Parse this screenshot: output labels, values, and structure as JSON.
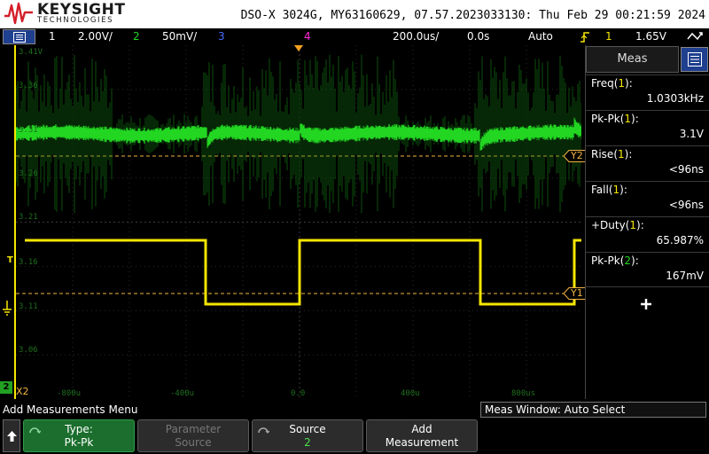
{
  "header": {
    "brand": "KEYSIGHT",
    "brand_sub": "TECHNOLOGIES",
    "device_info": "DSO-X 3024G, MY63160629, 07.57.2023033130: Thu Feb 29 00:21:59 2024"
  },
  "status": {
    "ch1_num": "1",
    "ch1_scale": "2.00V/",
    "ch2_num": "2",
    "ch2_scale": "50mV/",
    "ch3_num": "3",
    "ch4_num": "4",
    "timebase": "200.0us/",
    "delay": "0.0s",
    "trigger_mode": "Auto",
    "trigger_source": "1",
    "trigger_level": "1.65V"
  },
  "grid": {
    "y_labels": [
      "3.41V",
      "3.36",
      "3.31",
      "3.26",
      "3.21",
      "3.16",
      "3.11",
      "3.06"
    ],
    "x_labels": [
      "-800u",
      "-400u",
      "0.0",
      "400u",
      "800us"
    ],
    "marker_y2": "Y2",
    "marker_y1": "Y1",
    "marker_x2": "X2",
    "ch2_marker": "2",
    "trig_marker": "T"
  },
  "meas": {
    "tab_label": "Meas",
    "items": [
      {
        "name": "Freq",
        "src": "1",
        "value": "1.0303kHz"
      },
      {
        "name": "Pk-Pk",
        "src": "1",
        "value": "3.1V"
      },
      {
        "name": "Rise",
        "src": "1",
        "value": "<96ns"
      },
      {
        "name": "Fall",
        "src": "1",
        "value": "<96ns"
      },
      {
        "name": "+Duty",
        "src": "1",
        "value": "65.987%"
      },
      {
        "name": "Pk-Pk",
        "src": "2",
        "value": "167mV"
      }
    ]
  },
  "softkeys": {
    "menu_title": "Add Measurements Menu",
    "meas_window": "Meas Window: Auto Select",
    "type_label": "Type:",
    "type_value": "Pk-Pk",
    "param_label": "Parameter",
    "param_value": "Source",
    "source_label": "Source",
    "source_value": "2",
    "add_label": "Add",
    "add_value": "Measurement"
  },
  "colors": {
    "ch1": "#f5e600",
    "ch2": "#22d622",
    "ch3": "#4a6cff",
    "ch4": "#ff2ad8",
    "cursor": "#f2b440"
  }
}
